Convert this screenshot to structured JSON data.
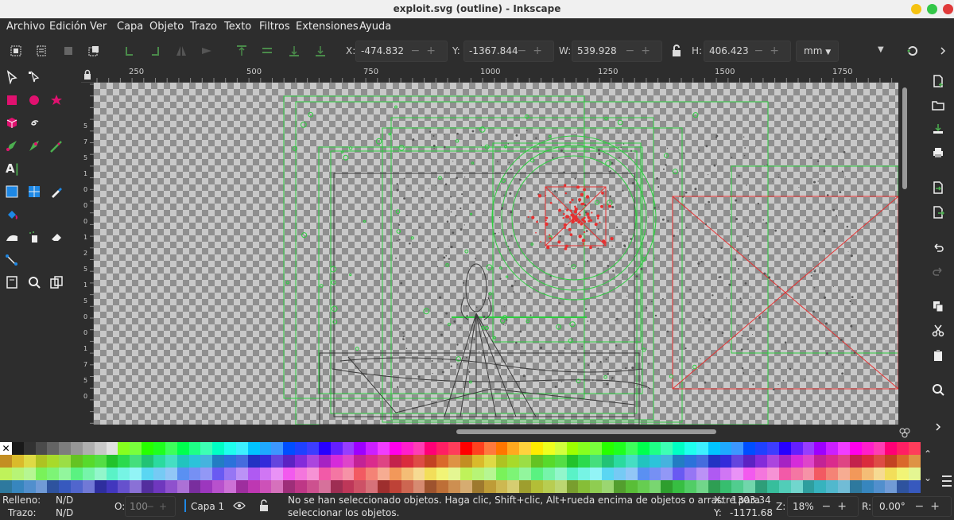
{
  "window": {
    "title": "exploit.svg (outline) - Inkscape"
  },
  "menu": [
    "Archivo",
    "Edición",
    "Ver",
    "Capa",
    "Objeto",
    "Trazo",
    "Texto",
    "Filtros",
    "Extensiones",
    "Ayuda"
  ],
  "controls": {
    "x_label": "X:",
    "x_value": "-474.832",
    "y_label": "Y:",
    "y_value": "-1367.844",
    "w_label": "W:",
    "w_value": "539.928",
    "h_label": "H:",
    "h_value": "406.423",
    "unit": "mm"
  },
  "ruler": {
    "h_ticks": [
      "250",
      "500",
      "750",
      "1000",
      "1250",
      "1500",
      "1750"
    ],
    "v_ticks": [
      "5",
      "7",
      "5",
      "1",
      "0",
      "0",
      "0",
      "1",
      "2",
      "5",
      "1",
      "5",
      "0",
      "0",
      "1",
      "7",
      "5",
      "0"
    ]
  },
  "status": {
    "fill_label": "Relleno:",
    "fill_value": "N/D",
    "stroke_label": "Trazo:",
    "stroke_value": "N/D",
    "opacity_label": "O:",
    "opacity_value": "100",
    "layer": "Capa 1",
    "message_line1": "No se han seleccionado objetos. Haga clic, Shift+clic, Alt+rueda encima de objetos o arrastre para",
    "message_line2": "seleccionar los objetos.",
    "x_label": "X:",
    "x_value": "1303.34",
    "y_label": "Y:",
    "y_value": "-1171.68",
    "zoom_label": "Z:",
    "zoom_value": "18%",
    "rotate_label": "R:",
    "rotate_value": "0.00°"
  },
  "colors": {
    "accent": "#e0116f",
    "guide_green": "#2ecc40",
    "red": "#e63030",
    "outline": "#3a3a3a"
  }
}
